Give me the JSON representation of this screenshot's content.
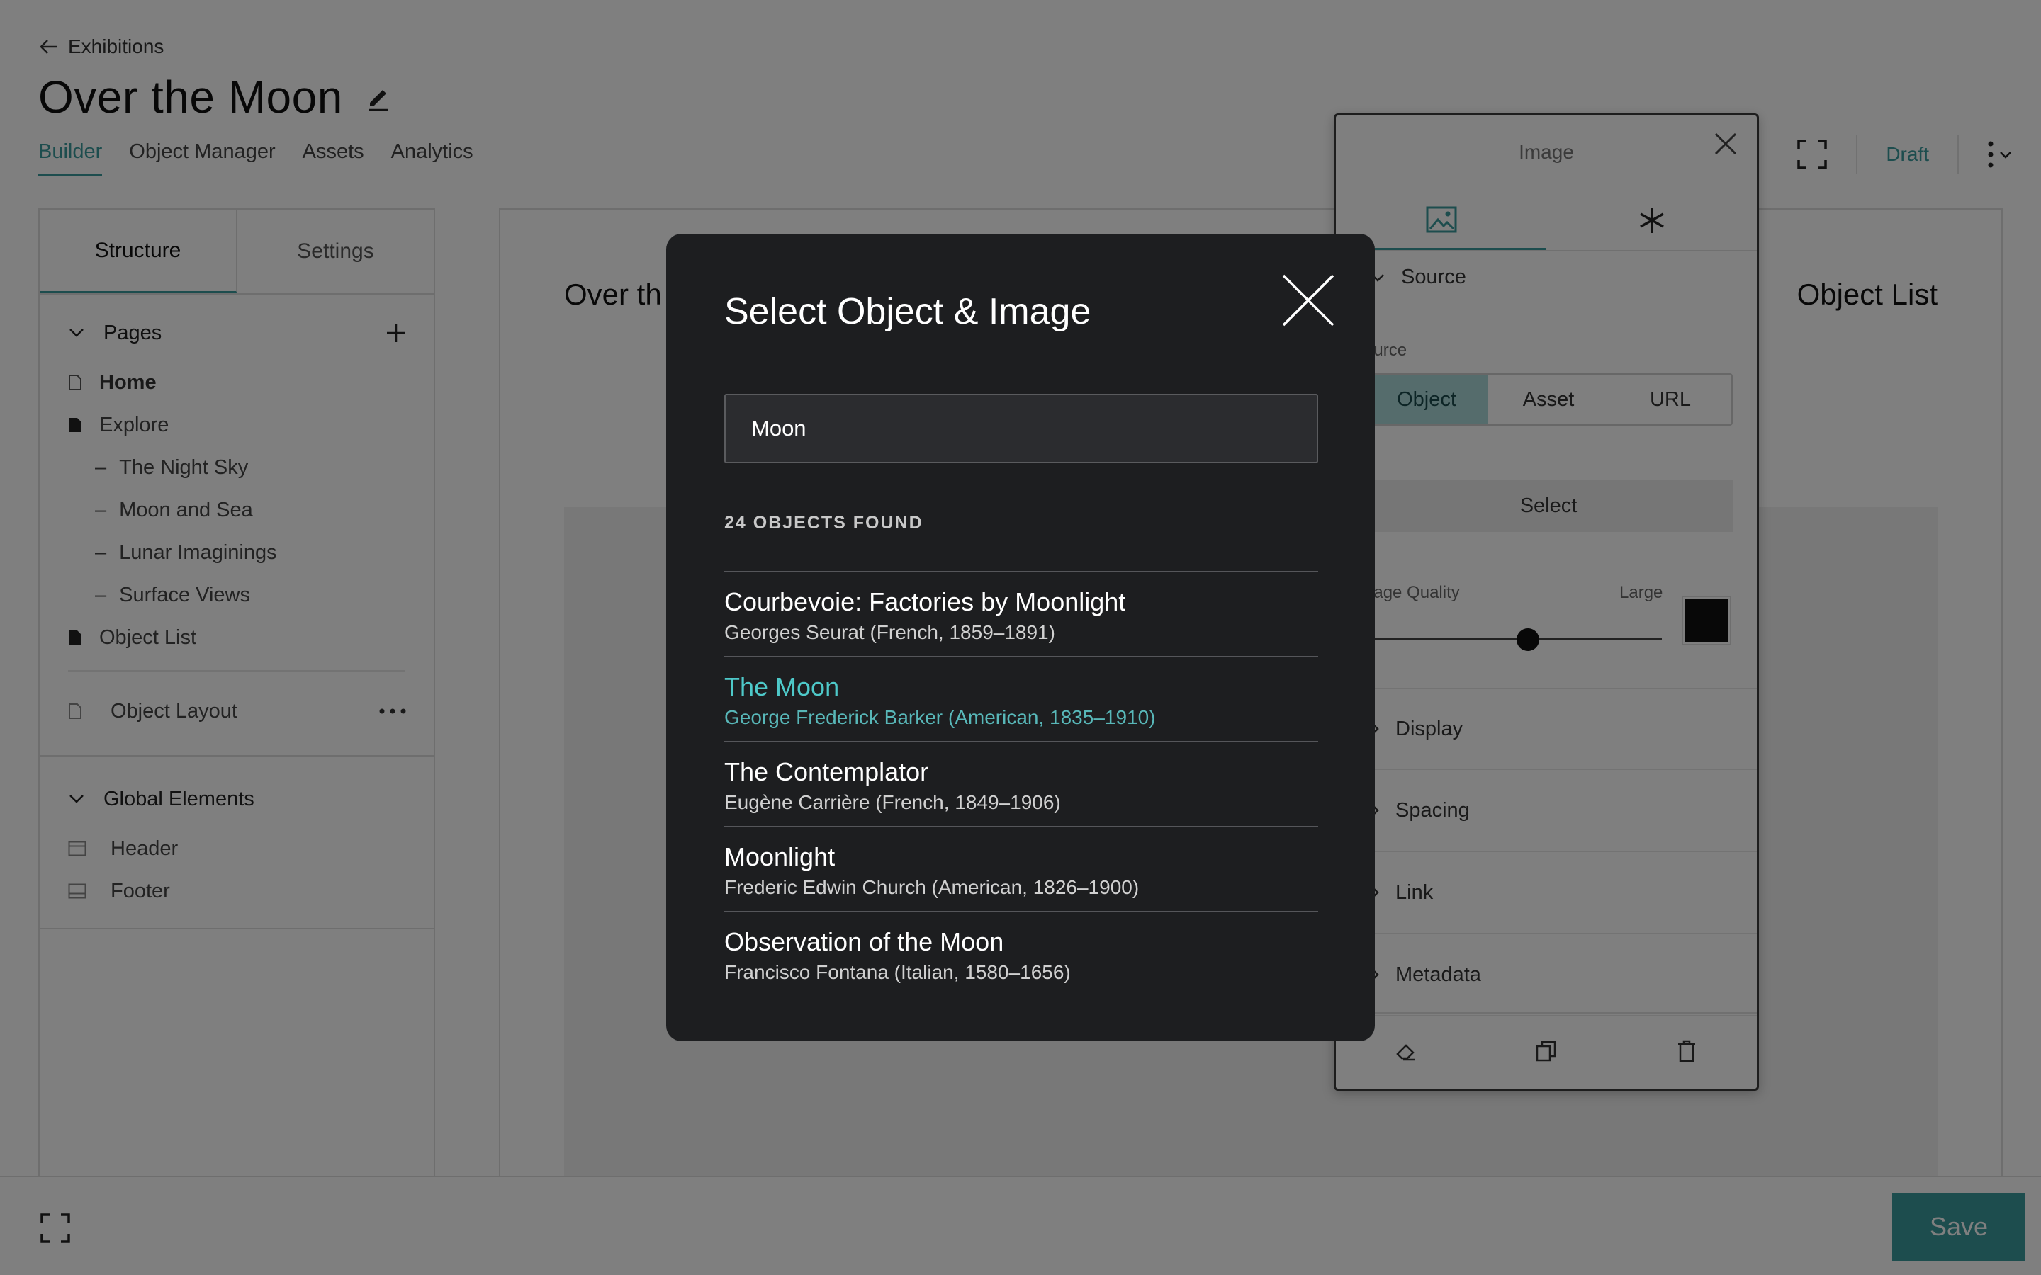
{
  "header": {
    "back_label": "Exhibitions",
    "title": "Over the Moon",
    "tabs": [
      "Builder",
      "Object Manager",
      "Assets",
      "Analytics"
    ],
    "draft_label": "Draft"
  },
  "sidebar": {
    "tabs": [
      "Structure",
      "Settings"
    ],
    "pages_label": "Pages",
    "pages": [
      {
        "label": "Home"
      },
      {
        "label": "Explore"
      },
      {
        "label": "The Night Sky"
      },
      {
        "label": "Moon and Sea"
      },
      {
        "label": "Lunar Imaginings"
      },
      {
        "label": "Surface Views"
      },
      {
        "label": "Object List"
      }
    ],
    "sub_dash": "–",
    "object_layout_label": "Object Layout",
    "global_label": "Global Elements",
    "global_items": [
      "Header",
      "Footer"
    ]
  },
  "canvas": {
    "left_title": "Over th",
    "right_title": "Object List"
  },
  "image_panel": {
    "title": "Image",
    "source_label": "Source",
    "source_small_label": "ource",
    "source_options": [
      "Object",
      "Asset",
      "URL"
    ],
    "select_label": "Select",
    "quality_label": "nage Quality",
    "quality_value_label": "Large",
    "quality_level": 0.55,
    "sections": [
      "Display",
      "Spacing",
      "Link",
      "Metadata"
    ]
  },
  "modal": {
    "title": "Select Object & Image",
    "search_value": "Moon",
    "results_count": "24 OBJECTS FOUND",
    "results": [
      {
        "title": "Courbevoie: Factories by Moonlight",
        "artist": "Georges Seurat (French, 1859–1891)"
      },
      {
        "title": "The Moon",
        "artist": "George Frederick Barker (American, 1835–1910)"
      },
      {
        "title": "The Contemplator",
        "artist": "Eugène Carrière (French, 1849–1906)"
      },
      {
        "title": "Moonlight",
        "artist": "Frederic Edwin Church (American, 1826–1900)"
      },
      {
        "title": "Observation of the Moon",
        "artist": "Francisco Fontana (Italian, 1580–1656)"
      }
    ]
  },
  "footer": {
    "save_label": "Save"
  },
  "colors": {
    "accent": "#3a9a9c",
    "modal_bg": "#1d1e20",
    "highlight": "#4ec9c9"
  }
}
